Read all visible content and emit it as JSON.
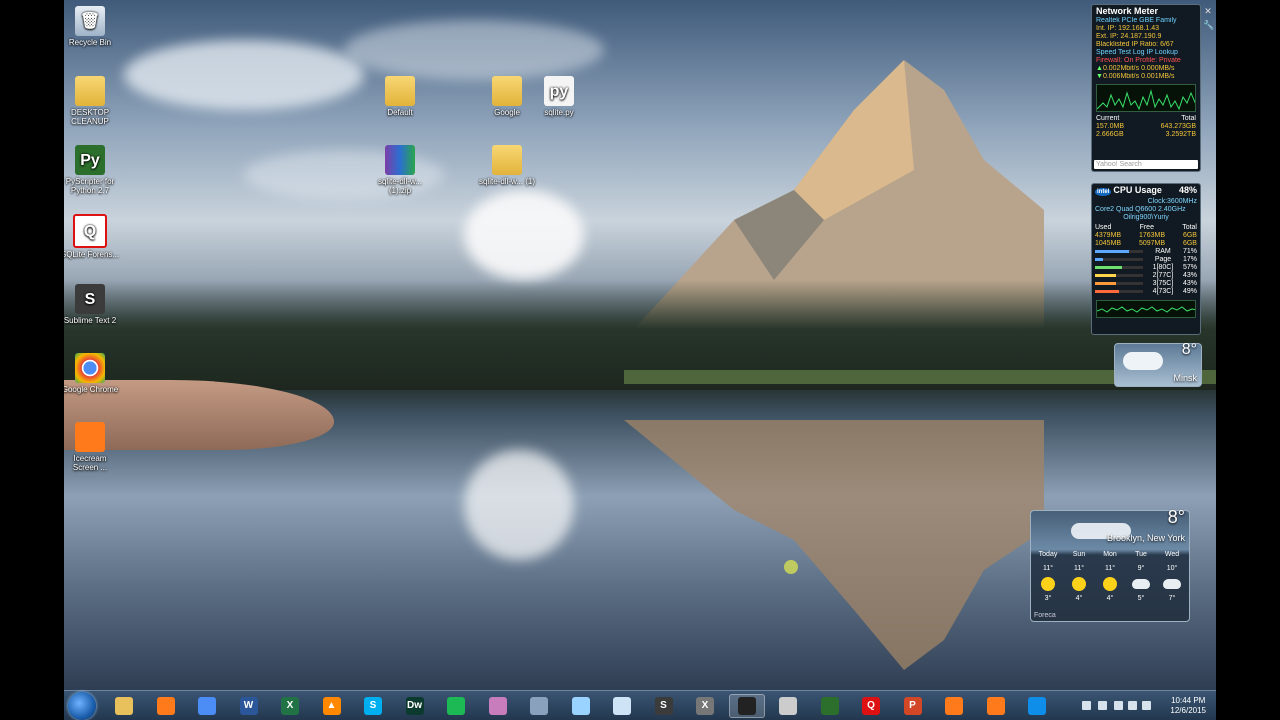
{
  "desktop": {
    "icons": [
      {
        "label": "Recycle Bin",
        "glyph": "🗑",
        "style": "g-bin"
      },
      {
        "label": "DESKTOP CLEANUP",
        "glyph": "",
        "style": "folder"
      },
      {
        "label": "PyScripter for Python 2.7",
        "glyph": "Py",
        "style": "g-py"
      },
      {
        "label": "SQLite Forens...",
        "glyph": "Q",
        "style": "g-sql"
      },
      {
        "label": "Sublime Text 2",
        "glyph": "S",
        "style": "g-sub"
      },
      {
        "label": "Google Chrome",
        "glyph": "",
        "style": "g-chrome"
      },
      {
        "label": "Icecream Screen ...",
        "glyph": "",
        "style": "g-orange"
      },
      {
        "label": "Default",
        "glyph": "",
        "style": "folder"
      },
      {
        "label": "Google",
        "glyph": "",
        "style": "folder"
      },
      {
        "label": "sqlite.py",
        "glyph": "py",
        "style": "g-file"
      },
      {
        "label": "sqlite-dll-w... (1).zip",
        "glyph": "",
        "style": "g-rar"
      },
      {
        "label": "sqlite-dll-w... (1)",
        "glyph": "",
        "style": "folder"
      }
    ]
  },
  "network_meter": {
    "title": "Network Meter",
    "adapter": "Realtek PCIe GBE Family",
    "int_ip": "Int. IP: 192.168.1.43",
    "ext_ip": "Ext. IP: 24.187.190.9",
    "blacklisted": "Blacklisted IP Ratio: 6/67",
    "links": "Speed Test    Log    IP Lookup",
    "firewall": "Firewall: On    Profile: Private",
    "rate_up": "0.002Mbit/s    0.000MB/s",
    "rate_down": "0.006Mbit/s    0.001MB/s",
    "current_label": "Current",
    "total_label": "Total",
    "cur_up": "157.0MB",
    "tot_up": "643.273GB",
    "cur_down": "2.666GB",
    "tot_down": "3.2592TB",
    "search_placeholder": "Yahoo! Search"
  },
  "cpu_meter": {
    "title": "CPU Usage",
    "percent": "48%",
    "brand": "intel",
    "clock": "Clock:3600MHz",
    "model": "Core2 Quad Q6600 2.40GHz",
    "user": "Oilrig900\\Yuriy",
    "headers": [
      "Used",
      "Free",
      "Total"
    ],
    "rows": [
      [
        "4379MB",
        "1763MB",
        "6GB"
      ],
      [
        "1045MB",
        "5097MB",
        "6GB"
      ]
    ],
    "stats": [
      {
        "label": "RAM",
        "value": "71%",
        "fill": 0.71,
        "color": "#5aa9ff"
      },
      {
        "label": "Page",
        "value": "17%",
        "fill": 0.17,
        "color": "#5aa9ff"
      },
      {
        "label": "1[80C]",
        "value": "57%",
        "fill": 0.57,
        "color": "#6ee06e"
      },
      {
        "label": "2[77C]",
        "value": "43%",
        "fill": 0.43,
        "color": "#ffd44a"
      },
      {
        "label": "3[75C]",
        "value": "43%",
        "fill": 0.43,
        "color": "#ff9a3a"
      },
      {
        "label": "4[73C]",
        "value": "49%",
        "fill": 0.49,
        "color": "#ff6a3a"
      }
    ]
  },
  "weather_small": {
    "temp": "8°",
    "city": "Minsk"
  },
  "weather_large": {
    "temp": "8°",
    "city": "Brooklyn, New York",
    "days": [
      {
        "name": "Today",
        "hi": "11°",
        "lo": "3°",
        "icon": "sun"
      },
      {
        "name": "Sun",
        "hi": "11°",
        "lo": "4°",
        "icon": "sun"
      },
      {
        "name": "Mon",
        "hi": "11°",
        "lo": "4°",
        "icon": "sun"
      },
      {
        "name": "Tue",
        "hi": "9°",
        "lo": "5°",
        "icon": "cloud"
      },
      {
        "name": "Wed",
        "hi": "10°",
        "lo": "7°",
        "icon": "cloud"
      }
    ],
    "provider": "Foreca"
  },
  "taskbar": {
    "apps": [
      {
        "name": "explorer",
        "glyph": "",
        "color": "#e8c15c"
      },
      {
        "name": "firefox",
        "glyph": "",
        "color": "#ff7a1a"
      },
      {
        "name": "chrome",
        "glyph": "",
        "color": "#4b8cf5"
      },
      {
        "name": "word",
        "glyph": "W",
        "color": "#2b579a"
      },
      {
        "name": "excel",
        "glyph": "X",
        "color": "#217346"
      },
      {
        "name": "vlc",
        "glyph": "▲",
        "color": "#ff8800"
      },
      {
        "name": "skype",
        "glyph": "S",
        "color": "#00aff0"
      },
      {
        "name": "dreamweaver",
        "glyph": "Dw",
        "color": "#0d3a2e"
      },
      {
        "name": "spotify",
        "glyph": "",
        "color": "#1db954"
      },
      {
        "name": "app-bug",
        "glyph": "",
        "color": "#c77dbb"
      },
      {
        "name": "app-network",
        "glyph": "",
        "color": "#8aa1bd"
      },
      {
        "name": "app-glass",
        "glyph": "",
        "color": "#9ad3ff"
      },
      {
        "name": "notepad",
        "glyph": "",
        "color": "#cfe3f7"
      },
      {
        "name": "sublime",
        "glyph": "S",
        "color": "#3b3b3b"
      },
      {
        "name": "app-x",
        "glyph": "X",
        "color": "#777"
      },
      {
        "name": "app-cat",
        "glyph": "",
        "color": "#222"
      },
      {
        "name": "app-pen",
        "glyph": "",
        "color": "#ccc"
      },
      {
        "name": "pyscripter",
        "glyph": "",
        "color": "#2c6e2c"
      },
      {
        "name": "sqlite-forensic",
        "glyph": "Q",
        "color": "#d11"
      },
      {
        "name": "powerpoint",
        "glyph": "P",
        "color": "#d24726"
      },
      {
        "name": "icecream1",
        "glyph": "",
        "color": "#ff7a1a"
      },
      {
        "name": "icecream2",
        "glyph": "",
        "color": "#ff7a1a"
      },
      {
        "name": "teamviewer",
        "glyph": "",
        "color": "#0e8ee9"
      }
    ],
    "time": "10:44 PM",
    "date": "12/6/2015"
  }
}
